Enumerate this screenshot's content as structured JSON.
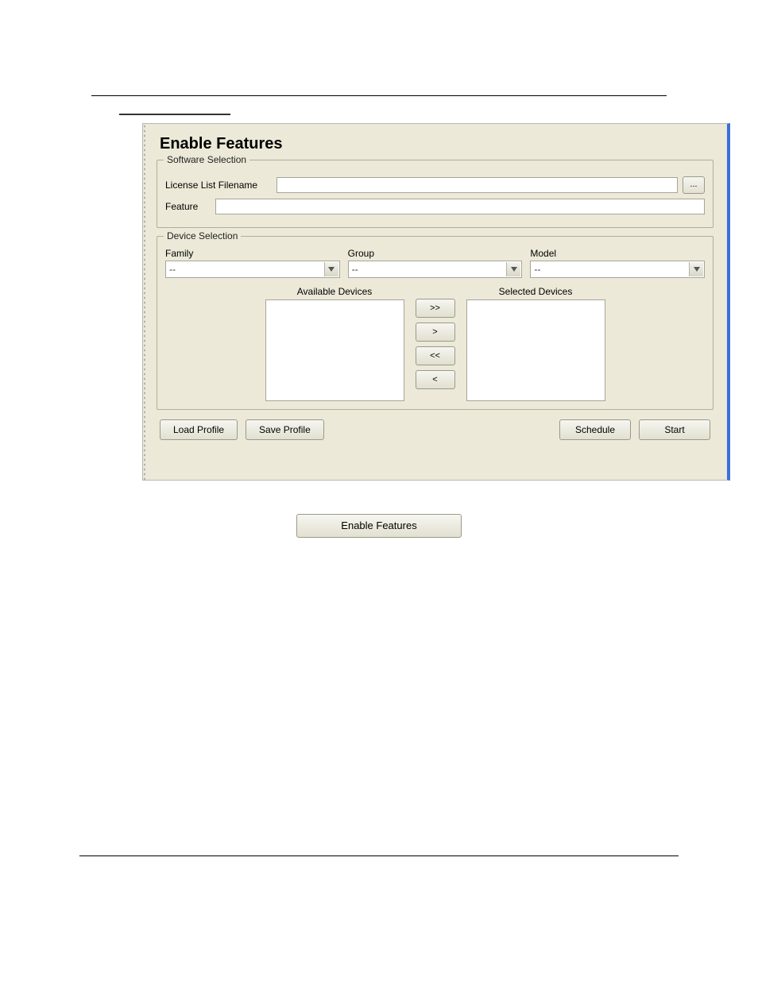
{
  "panel": {
    "title": "Enable Features",
    "software_section": {
      "legend": "Software Selection",
      "license_label": "License List Filename",
      "license_value": "",
      "browse_label": "...",
      "feature_label": "Feature",
      "feature_value": ""
    },
    "device_section": {
      "legend": "Device Selection",
      "family_label": "Family",
      "family_value": "--",
      "group_label": "Group",
      "group_value": "--",
      "model_label": "Model",
      "model_value": "--",
      "available_label": "Available Devices",
      "selected_label": "Selected Devices",
      "move_all_right": ">>",
      "move_right": ">",
      "move_all_left": "<<",
      "move_left": "<"
    },
    "buttons": {
      "load_profile": "Load Profile",
      "save_profile": "Save Profile",
      "schedule": "Schedule",
      "start": "Start"
    }
  },
  "standalone_button": "Enable Features"
}
